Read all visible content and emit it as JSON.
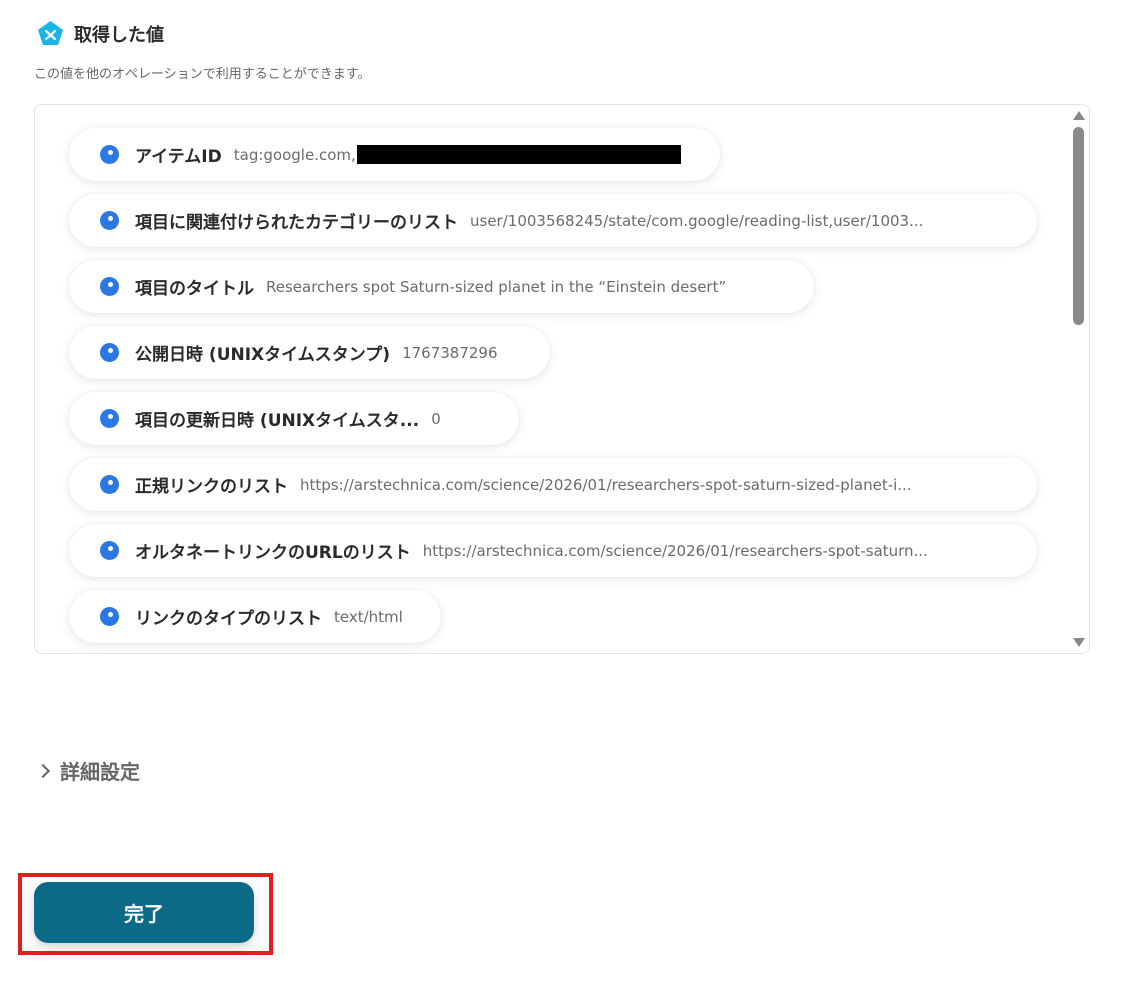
{
  "section": {
    "title": "取得した値",
    "description": "この値を他のオペレーションで利用することができます。",
    "logo_icon": "yoom-logo-icon",
    "accent_color": "#18b6e8"
  },
  "values": [
    {
      "label": "アイテムID",
      "value": "tag:google.com,",
      "redacted": true
    },
    {
      "label": "項目に関連付けられたカテゴリーのリスト",
      "value": "user/1003568245/state/com.google/reading-list,user/1003..."
    },
    {
      "label": "項目のタイトル",
      "value": "Researchers spot Saturn-sized planet in the “Einstein desert”"
    },
    {
      "label": "公開日時 (UNIXタイムスタンプ)",
      "value": "1767387296"
    },
    {
      "label": "項目の更新日時 (UNIXタイムスタ...",
      "value": "0"
    },
    {
      "label": "正規リンクのリスト",
      "value": "https://arstechnica.com/science/2026/01/researchers-spot-saturn-sized-planet-i..."
    },
    {
      "label": "オルタネートリンクのURLのリスト",
      "value": "https://arstechnica.com/science/2026/01/researchers-spot-saturn..."
    },
    {
      "label": "リンクのタイプのリスト",
      "value": "text/html"
    }
  ],
  "advanced": {
    "label": "詳細設定"
  },
  "complete_button": {
    "label": "完了",
    "color": "#0b6a86"
  },
  "highlight_color": "#e0201f",
  "dot_color": "#2a78e4"
}
